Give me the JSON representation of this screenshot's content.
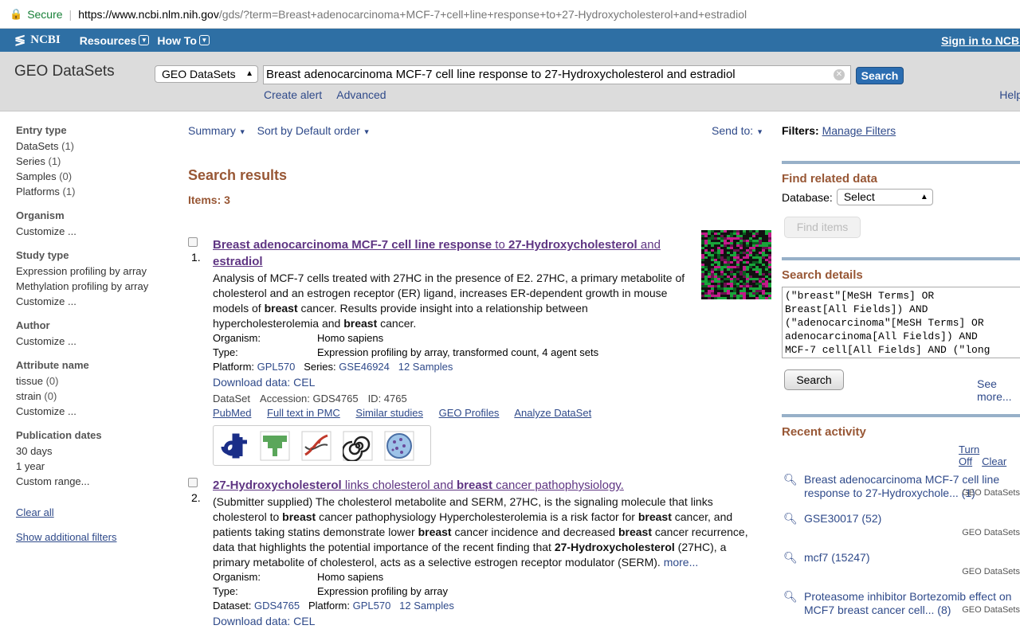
{
  "address_bar": {
    "secure_label": "Secure",
    "url_host": "https://www.ncbi.nlm.nih.gov",
    "url_rest": "/gds/?term=Breast+adenocarcinoma+MCF-7+cell+line+response+to+27-Hydroxycholesterol+and+estradiol"
  },
  "ncbi_bar": {
    "logo": "NCBI",
    "resources": "Resources",
    "howto": "How To",
    "signin": "Sign in to NCBI"
  },
  "search_header": {
    "db_title": "GEO DataSets",
    "db_select": "GEO DataSets",
    "query": "Breast adenocarcinoma MCF-7 cell line response to 27-Hydroxycholesterol and estradiol",
    "search_button": "Search",
    "create_alert": "Create alert",
    "advanced": "Advanced",
    "help": "Help"
  },
  "sidebar": {
    "groups": [
      {
        "heading": "Entry type",
        "items": [
          {
            "label": "DataSets",
            "count": "(1)"
          },
          {
            "label": "Series",
            "count": "(1)"
          },
          {
            "label": "Samples",
            "count": "(0)"
          },
          {
            "label": "Platforms",
            "count": "(1)"
          }
        ]
      },
      {
        "heading": "Organism",
        "items": [
          {
            "label": "Customize ...",
            "count": ""
          }
        ]
      },
      {
        "heading": "Study type",
        "items": [
          {
            "label": "Expression profiling by array",
            "count": ""
          },
          {
            "label": "Methylation profiling by array",
            "count": ""
          },
          {
            "label": "Customize ...",
            "count": ""
          }
        ]
      },
      {
        "heading": "Author",
        "items": [
          {
            "label": "Customize ...",
            "count": ""
          }
        ]
      },
      {
        "heading": "Attribute name",
        "items": [
          {
            "label": "tissue",
            "count": "(0)"
          },
          {
            "label": "strain",
            "count": "(0)"
          },
          {
            "label": "Customize ...",
            "count": ""
          }
        ]
      },
      {
        "heading": "Publication dates",
        "items": [
          {
            "label": "30 days",
            "count": ""
          },
          {
            "label": "1 year",
            "count": ""
          },
          {
            "label": "Custom range...",
            "count": ""
          }
        ]
      }
    ],
    "clear_all": "Clear all",
    "show_filters": "Show additional filters"
  },
  "toolbar": {
    "summary": "Summary",
    "sort": "Sort by Default order",
    "send_to": "Send to:"
  },
  "results": {
    "heading": "Search results",
    "items": "Items: 3",
    "r1": {
      "num": "1.",
      "title_a": "Breast adenocarcinoma MCF-7 cell line response",
      "title_b": " to ",
      "title_c": "27-Hydroxycholesterol",
      "title_d": " and ",
      "title_e": "estradiol",
      "desc_a": "Analysis of MCF-7 cells treated with 27HC in the presence of E2. 27HC, a primary metabolite of cholesterol and an estrogen receptor (ER) ligand, increases ER-dependent growth in mouse models of ",
      "desc_b": "breast",
      "desc_c": " cancer. Results provide insight into a relationship between hypercholesterolemia and ",
      "desc_d": "breast",
      "desc_e": " cancer.",
      "organism_k": "Organism:",
      "organism_v": "Homo sapiens",
      "type_k": "Type:",
      "type_v": "Expression profiling by array, transformed count, 4 agent sets",
      "platform_k": "Platform:",
      "platform_v": "GPL570",
      "series_k": "Series:",
      "series_v": "GSE46924",
      "samples": "12 Samples",
      "download": "Download data: CEL",
      "dataset": "DataSet",
      "accession": "Accession: GDS4765",
      "id": "ID: 4765",
      "links": [
        "PubMed",
        "Full text in PMC",
        "Similar studies",
        "GEO Profiles",
        "Analyze DataSet"
      ]
    },
    "r2": {
      "num": "2.",
      "title_a": "27-Hydroxycholesterol",
      "title_b": " links cholesterol and ",
      "title_c": "breast",
      "title_d": " cancer pathophysiology.",
      "desc_1": "(Submitter supplied) The cholesterol metabolite and SERM, 27HC, is the signaling molecule that links cholesterol to ",
      "desc_2": "breast",
      "desc_3": " cancer pathophysiology Hypercholesterolemia is a risk factor for ",
      "desc_4": "breast",
      "desc_5": " cancer, and patients taking statins demonstrate lower ",
      "desc_6": "breast",
      "desc_7": " cancer incidence and decreased ",
      "desc_8": "breast",
      "desc_9": " cancer recurrence, data that highlights the potential importance of the recent finding that ",
      "desc_10": "27-Hydroxycholesterol",
      "desc_11": " (27HC), a primary metabolite of cholesterol, acts as a selective estrogen receptor modulator (SERM). ",
      "more": "more...",
      "organism_k": "Organism:",
      "organism_v": "Homo sapiens",
      "type_k": "Type:",
      "type_v": "Expression profiling by array",
      "dataset_k": "Dataset:",
      "dataset_v": "GDS4765",
      "platform_k": "Platform:",
      "platform_v": "GPL570",
      "samples": "12 Samples",
      "download": "Download data: CEL"
    }
  },
  "right": {
    "filters_label": "Filters:",
    "manage_filters": "Manage Filters",
    "find_related": "Find related data",
    "database_label": "Database:",
    "database_select": "Select",
    "find_items": "Find items",
    "search_details": "Search details",
    "query_lines": [
      "(\"breast\"[MeSH Terms] OR",
      "Breast[All Fields]) AND",
      "(\"adenocarcinoma\"[MeSH Terms] OR",
      "adenocarcinoma[All Fields]) AND",
      "MCF-7 cell[All Fields] AND (\"long"
    ],
    "search_btn": "Search",
    "see_more": "See more...",
    "recent_activity": "Recent activity",
    "turn_off": "Turn Off",
    "clear": "Clear",
    "recent": [
      {
        "text": "Breast adenocarcinoma MCF-7 cell line response to 27-Hydroxychole...",
        "count": "(1)",
        "src": "GEO DataSets"
      },
      {
        "text": "GSE30017",
        "count": "(52)",
        "src": "GEO DataSets"
      },
      {
        "text": "mcf7",
        "count": "(15247)",
        "src": "GEO DataSets"
      },
      {
        "text": "Proteasome inhibitor Bortezomib effect on MCF7 breast cancer cell...",
        "count": "(8)",
        "src": "GEO DataSets"
      }
    ]
  },
  "colors": {
    "ncbi_blue": "#2e6fa4",
    "section_brown": "#985735",
    "visited_purple": "#5f3583",
    "link_blue": "#2f4a8a"
  }
}
